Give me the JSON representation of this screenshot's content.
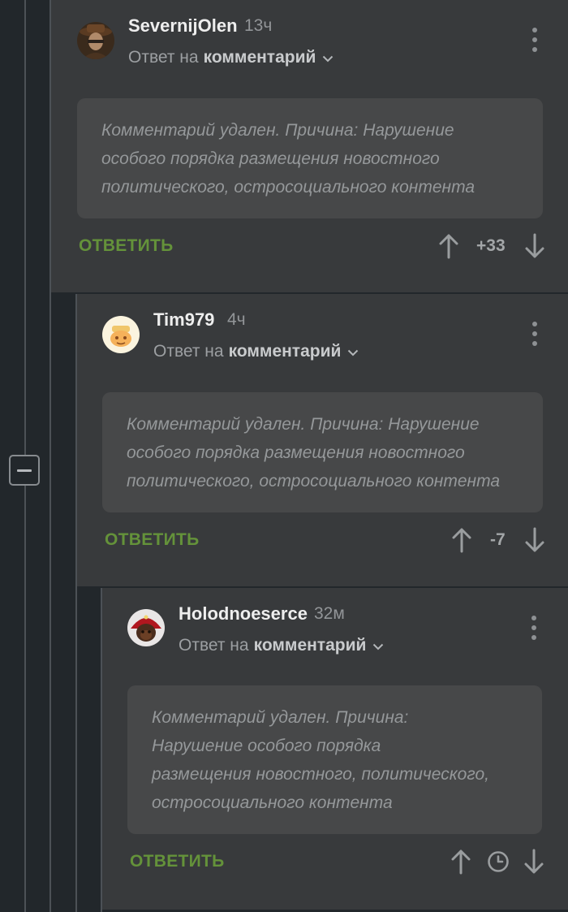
{
  "ui": {
    "collapse_icon": "minus-icon",
    "more_icon": "more-vertical-icon",
    "upvote_icon": "arrow-up-icon",
    "downvote_icon": "arrow-down-icon",
    "pending_icon": "clock-icon",
    "accent_color": "#64923a"
  },
  "comments": [
    {
      "author": "SevernijOlen",
      "time": "13ч",
      "reply_prefix": "Ответ на",
      "reply_link": "комментарий",
      "deleted_lines": [
        "Комментарий удален. Причина: Нарушение",
        "особого порядка размещения новостного",
        "политического, остросоциального контента"
      ],
      "reply_label": "ОТВЕТИТЬ",
      "rating": "+33"
    },
    {
      "author": "Tim979",
      "time": "4ч",
      "reply_prefix": "Ответ на",
      "reply_link": "комментарий",
      "deleted_lines": [
        "Комментарий удален. Причина: Нарушение",
        "особого порядка размещения новостного",
        "политического, остросоциального контента"
      ],
      "reply_label": "ОТВЕТИТЬ",
      "rating": "-7"
    },
    {
      "author": "Holodnoeserce",
      "time": "32м",
      "reply_prefix": "Ответ на",
      "reply_link": "комментарий",
      "deleted_lines": [
        "Комментарий удален. Причина:",
        "Нарушение особого порядка",
        "размещения новостного, политического,",
        "остросоциального контента"
      ],
      "reply_label": "ОТВЕТИТЬ",
      "rating": ""
    }
  ]
}
